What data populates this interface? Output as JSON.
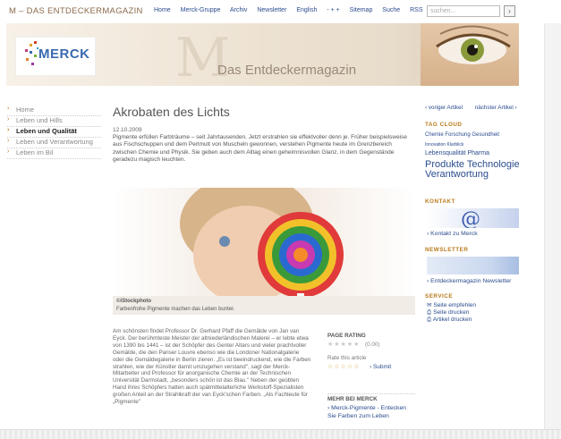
{
  "header": {
    "site_title": "M – DAS ENTDECKERMAGAZIN",
    "nav": [
      "Home",
      "Merck-Gruppe",
      "Archiv",
      "Newsletter",
      "English",
      "- + +",
      "Sitemap",
      "Suche",
      "RSS"
    ],
    "search_placeholder": "suchen...",
    "search_button": "›"
  },
  "banner": {
    "logo": "MERCK",
    "big_letter": "M",
    "title": "Das Entdeckermagazin"
  },
  "leftnav": {
    "items": [
      {
        "label": "Home",
        "active": false
      },
      {
        "label": "Leben und Hills",
        "active": false
      },
      {
        "label": "Leben und Qualität",
        "active": true
      },
      {
        "label": "Leben und Verantwortung",
        "active": false
      },
      {
        "label": "Leben im Bil",
        "active": false
      }
    ]
  },
  "article": {
    "title": "Akrobaten des Lichts",
    "date": "12.10.2009",
    "intro": "Pigmente erfüllen Farbträume – seit Jahrtausenden. Jetzt erstrahlen sie effektvoller denn je. Früher beispielsweise aus Fischschuppen und dem Perlmutt von Muscheln gewonnen, verstehen Pigmente heute im Grenzbereich zwischen Chemie und Physik. Sie geben auch dem Alltag einen geheimnisvollen Glanz, in dem Gegenstände geradezu magisch leuchten.",
    "caption_credit": "©iStockphoto",
    "caption": "Farbenfrohe Pigmente machen das Leben bunter.",
    "body": "Am schönsten findet Professor Dr. Gerhard Pfaff die Gemälde von Jan van Eyck. Der berühmteste Meister der altniederländischen Malerei – er lebte etwa von 1390 bis 1441 – ist der Schöpfer des Genter Altars und vieler prachtvoller Gemälde, die den Pariser Louvre ebenso wie die Londoner Nationalgalerie oder die Gemäldegalerie in Berlin zieren. „Es ist beeindruckend, wie die Farben strahlen, wie der Künstler damit umzugehen verstand\", sagt der Merck-Mitarbeiter und Professor für anorganische Chemie an der Technischen Universität Darmstadt, „besonders schön ist das Blau.\" Neben der geübten Hand ihres Schöpfers hatten auch spätmittelalterliche Werkstoff-Spezialisten großen Anteil an der Strahlkraft der van Eyck'schen Farben. „Als Fachleute für „Pigmente\""
  },
  "rating": {
    "heading": "PAGE RATING",
    "stars": "★★★★★",
    "count": "(0.00)",
    "rate_label": "Rate this article",
    "rate_stars": "☆☆☆☆☆",
    "submit": "› Submit"
  },
  "more": {
    "heading": "MEHR BEI MERCK",
    "link": "› Merck-Pigmente - Entecken Sie Farben zum Leben"
  },
  "sidebar": {
    "prev": "‹ voriger Artikel",
    "next": "nächster Artikel ›",
    "tags_head": "TAG CLOUD",
    "tags": [
      "Chemie Forschung Gesundheit",
      "Innovation Klarblick",
      "Lebensqualität Pharma",
      "Produkte Technologie Verantwortung"
    ],
    "kontakt_head": "KONTAKT",
    "kontakt_link": "› Kontakt zu Merck",
    "newsletter_head": "NEWSLETTER",
    "newsletter_link": "› Entdeckermagazin Newsletter",
    "service_head": "SERVICE",
    "service_items": [
      "✉ Seite empfehlen",
      "⎙ Seite drucken",
      "⎙ Artikel drucken"
    ]
  },
  "colors": {
    "link": "#2a4c8e",
    "accent": "#b87a1a",
    "banner": "#ece1d0"
  }
}
